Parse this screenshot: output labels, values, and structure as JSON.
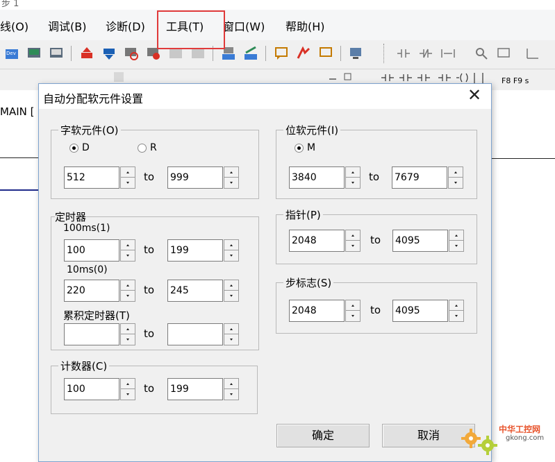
{
  "app": {
    "title_fragment": "步 1",
    "menus": [
      "线(O)",
      "调试(B)",
      "诊断(D)",
      "工具(T)",
      "窗口(W)",
      "帮助(H)"
    ],
    "toolbar2_fragment": "F8  F9 s",
    "main_tab": "MAIN [",
    "highlight_color": "#e03a3a"
  },
  "dialog": {
    "title": "自动分配软元件设置",
    "close_glyph": "✕",
    "word_devices": {
      "legend": "字软元件(O)",
      "radio_d": "D",
      "radio_r": "R",
      "selected": "D",
      "from": "512",
      "to": "999"
    },
    "bit_devices": {
      "legend": "位软元件(I)",
      "radio_m": "M",
      "from": "3840",
      "to": "7679"
    },
    "timers": {
      "legend": "定时器",
      "t100_label": "100ms(1)",
      "t100_from": "100",
      "t100_to": "199",
      "t10_label": "10ms(0)",
      "t10_from": "220",
      "t10_to": "245",
      "accum_label": "累积定时器(T)",
      "accum_from": "",
      "accum_to": ""
    },
    "pointer": {
      "legend": "指针(P)",
      "from": "2048",
      "to": "4095"
    },
    "step_relay": {
      "legend": "步标志(S)",
      "from": "2048",
      "to": "4095"
    },
    "counter": {
      "legend": "计数器(C)",
      "from": "100",
      "to": "199"
    },
    "to_label": "to",
    "ok_label": "确定",
    "cancel_label": "取消"
  },
  "watermark": {
    "line1": "中华工控网",
    "line2": "gkong.com"
  }
}
